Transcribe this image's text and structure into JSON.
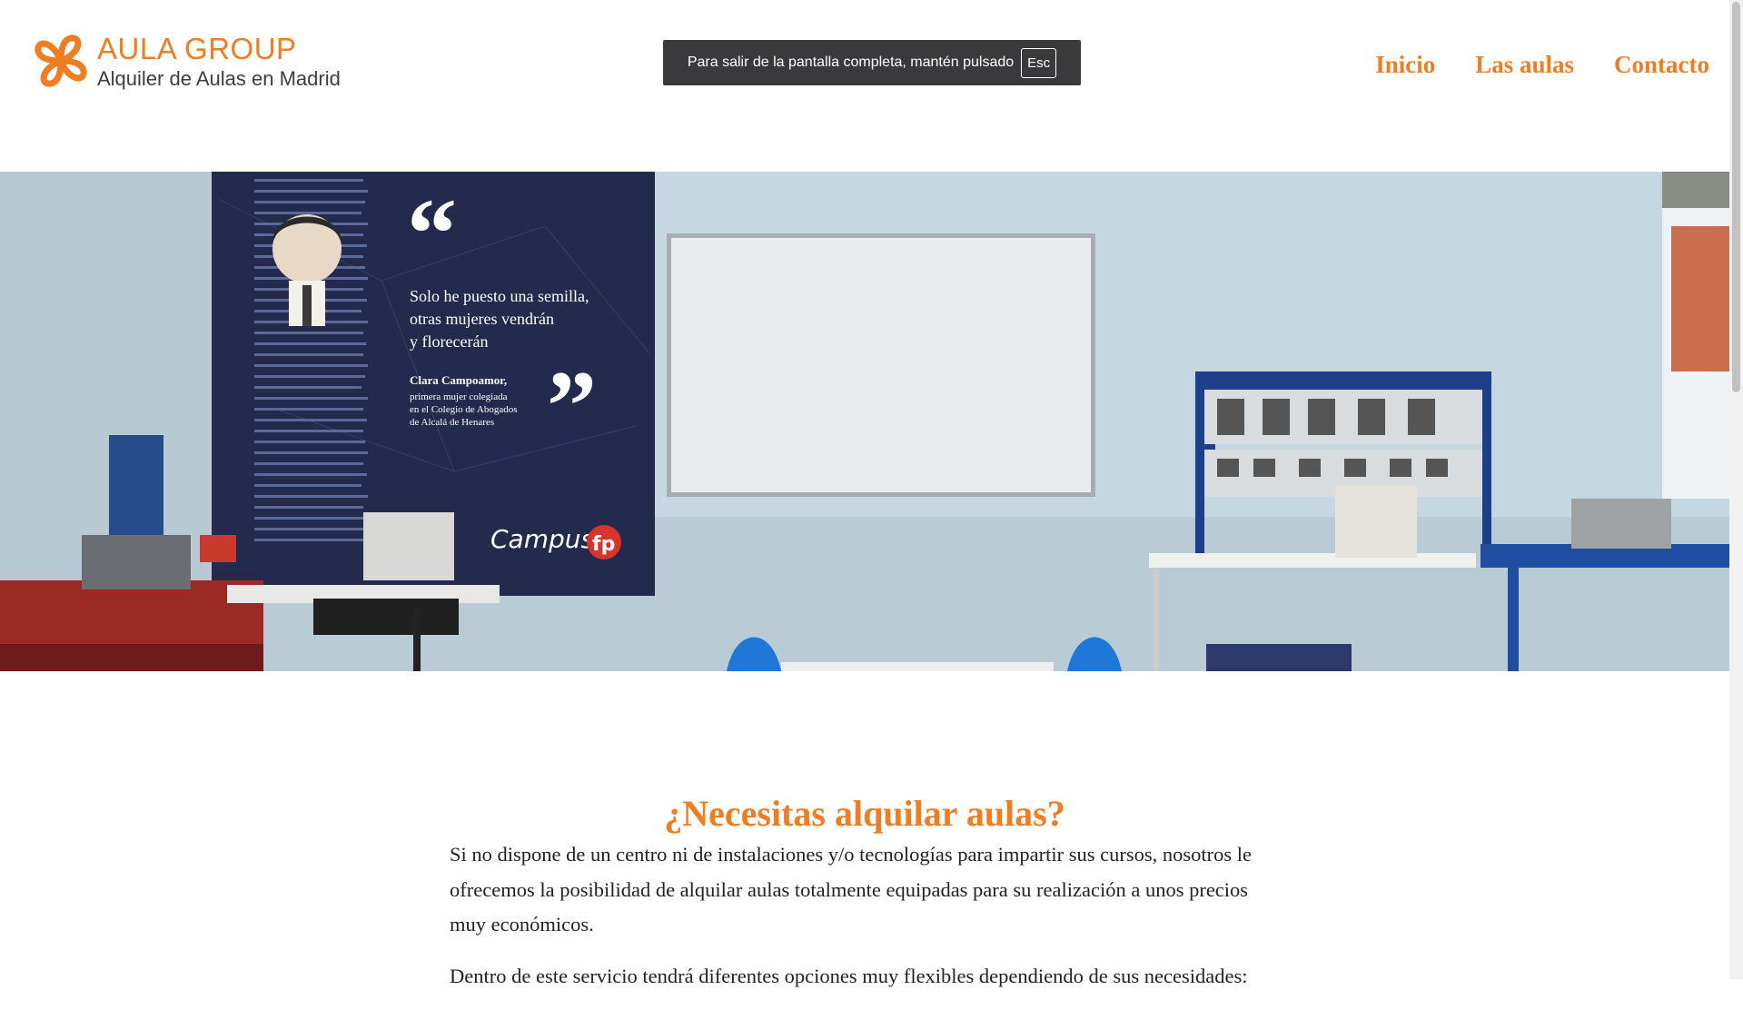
{
  "header": {
    "logo": {
      "title": "AULA GROUP",
      "subtitle": "Alquiler de Aulas en Madrid",
      "icon": "clover-logo-icon"
    },
    "nav": [
      {
        "label": "Inicio"
      },
      {
        "label": "Las aulas"
      },
      {
        "label": "Contacto"
      }
    ]
  },
  "fullscreen_notice": {
    "text": "Para salir de la pantalla completa, mantén pulsado",
    "key": "Esc"
  },
  "hero": {
    "quote_lines": [
      "Solo he puesto una semilla,",
      "otras mujeres vendrán",
      "y florecerán"
    ],
    "quote_author": "Clara Campoamor,",
    "quote_author_desc": [
      "primera mujer colegiada",
      "en el Colegio de Abogados",
      "de Alcalá de Henares"
    ],
    "banner_brand": "Campus",
    "banner_brand_badge": "fp"
  },
  "main": {
    "title": "¿Necesitas alquilar aulas?",
    "paragraphs": [
      "Si no dispone de un centro ni de instalaciones y/o tecnologías para impartir sus cursos, nosotros le ofrecemos la posibilidad de alquilar aulas totalmente equipadas para su realización a unos precios muy económicos.",
      "Dentro de este servicio tendrá diferentes opciones muy flexibles dependiendo de sus necesidades:"
    ]
  },
  "colors": {
    "accent": "#ef7d22",
    "text": "#222222"
  }
}
